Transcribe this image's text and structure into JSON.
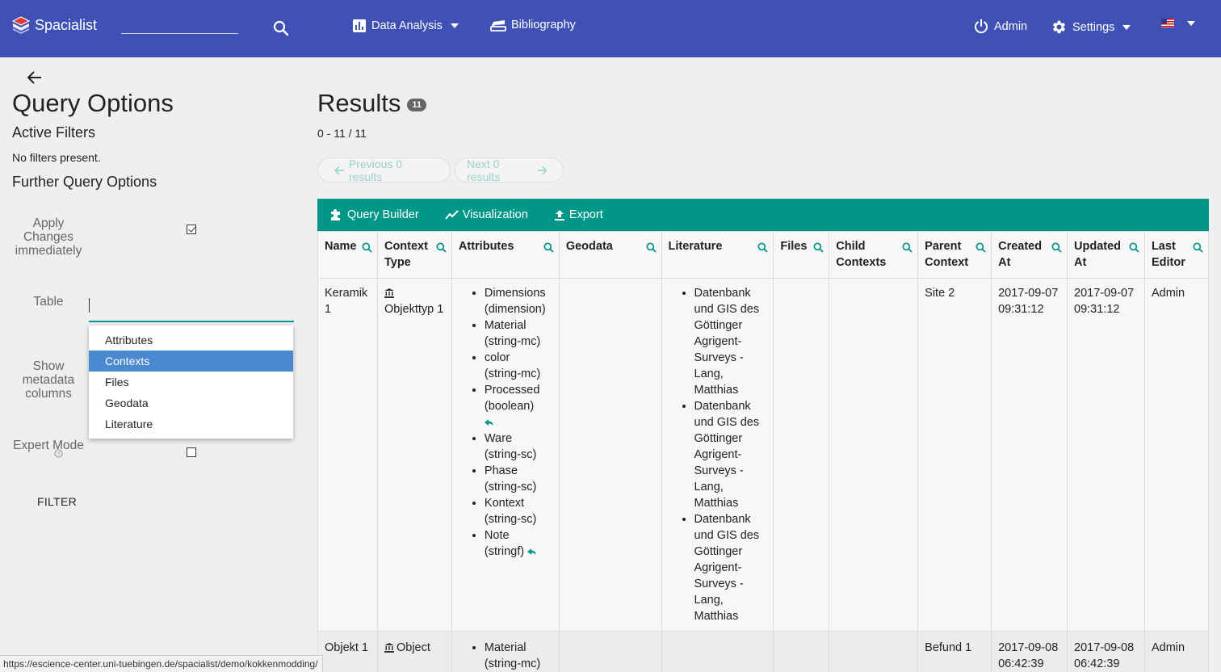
{
  "navbar": {
    "brand": "Spacialist",
    "search_placeholder": "",
    "data_analysis": "Data Analysis",
    "bibliography": "Bibliography",
    "admin": "Admin",
    "settings": "Settings",
    "language_icon": "us-flag-icon",
    "colors": {
      "bar": "#3f51b5"
    }
  },
  "left": {
    "title": "Query Options",
    "active_filters": "Active Filters",
    "no_filters": "No filters present.",
    "further_options": "Further Query Options",
    "apply_label": "Apply Changes immediately",
    "apply_checked": true,
    "table_label": "Table",
    "table_value": "",
    "dropdown_options": [
      "Attributes",
      "Contexts",
      "Files",
      "Geodata",
      "Literature"
    ],
    "dropdown_selected": "Contexts",
    "meta_label": "Show metadata columns",
    "expert_label": "Expert Mode",
    "expert_checked": false,
    "filter_button": "FILTER"
  },
  "results": {
    "title": "Results",
    "count": "11",
    "range": "0 - 11 / 11",
    "prev": "Previous 0 results",
    "next": "Next 0 results",
    "toolbar": {
      "query_builder": "Query Builder",
      "visualization": "Visualization",
      "export": "Export"
    },
    "columns": [
      {
        "l1": "Name",
        "l2": ""
      },
      {
        "l1": "Context",
        "l2": "Type"
      },
      {
        "l1": "Attributes",
        "l2": ""
      },
      {
        "l1": "Geodata",
        "l2": ""
      },
      {
        "l1": "Literature",
        "l2": ""
      },
      {
        "l1": "Files",
        "l2": ""
      },
      {
        "l1": "Child",
        "l2": "Contexts"
      },
      {
        "l1": "Parent",
        "l2": "Context"
      },
      {
        "l1": "Created",
        "l2": "At"
      },
      {
        "l1": "Updated",
        "l2": "At"
      },
      {
        "l1": "Last",
        "l2": "Editor"
      }
    ],
    "rows": [
      {
        "name_l1": "Keramik",
        "name_l2": "1",
        "context_type": "Objekttyp 1",
        "attributes": [
          {
            "t1": "Dimensions",
            "t2": "(dimension)"
          },
          {
            "t1": "Material",
            "t2": "(string-mc)"
          },
          {
            "t1": "color",
            "t2": "(string-mc)"
          },
          {
            "t1": "Processed",
            "t2": "(boolean)"
          },
          {
            "t1": "Ware",
            "t2": "(string-sc)"
          },
          {
            "t1": "Phase",
            "t2": "(string-sc)"
          },
          {
            "t1": "Kontext",
            "t2": "(string-sc)"
          },
          {
            "t1": "Note",
            "t2": "(stringf)"
          }
        ],
        "literature": [
          {
            "lines": [
              "Datenbank",
              "und GIS des",
              "Göttinger",
              "Agrigent-",
              "Surveys -",
              "Lang,",
              "Matthias"
            ]
          },
          {
            "lines": [
              "Datenbank",
              "und GIS des",
              "Göttinger",
              "Agrigent-",
              "Surveys -",
              "Lang,",
              "Matthias"
            ]
          },
          {
            "lines": [
              "Datenbank",
              "und GIS des",
              "Göttinger",
              "Agrigent-",
              "Surveys -",
              "Lang,",
              "Matthias"
            ]
          }
        ],
        "parent": "Site 2",
        "created_1": "2017-09-07",
        "created_2": "09:31:12",
        "updated_1": "2017-09-07",
        "updated_2": "09:31:12",
        "editor": "Admin"
      },
      {
        "name_l1": "Objekt 1",
        "context_type": "Object",
        "attr_t1": "Material",
        "attr_t2": "(string-mc)",
        "parent": "Befund 1",
        "created_1": "2017-09-08",
        "created_2": "06:42:39",
        "updated_1": "2017-09-08",
        "updated_2": "06:42:39",
        "editor": "Admin"
      }
    ]
  },
  "status_url": "https://escience-center.uni-tuebingen.de/spacialist/demo/kokkenmodding/"
}
